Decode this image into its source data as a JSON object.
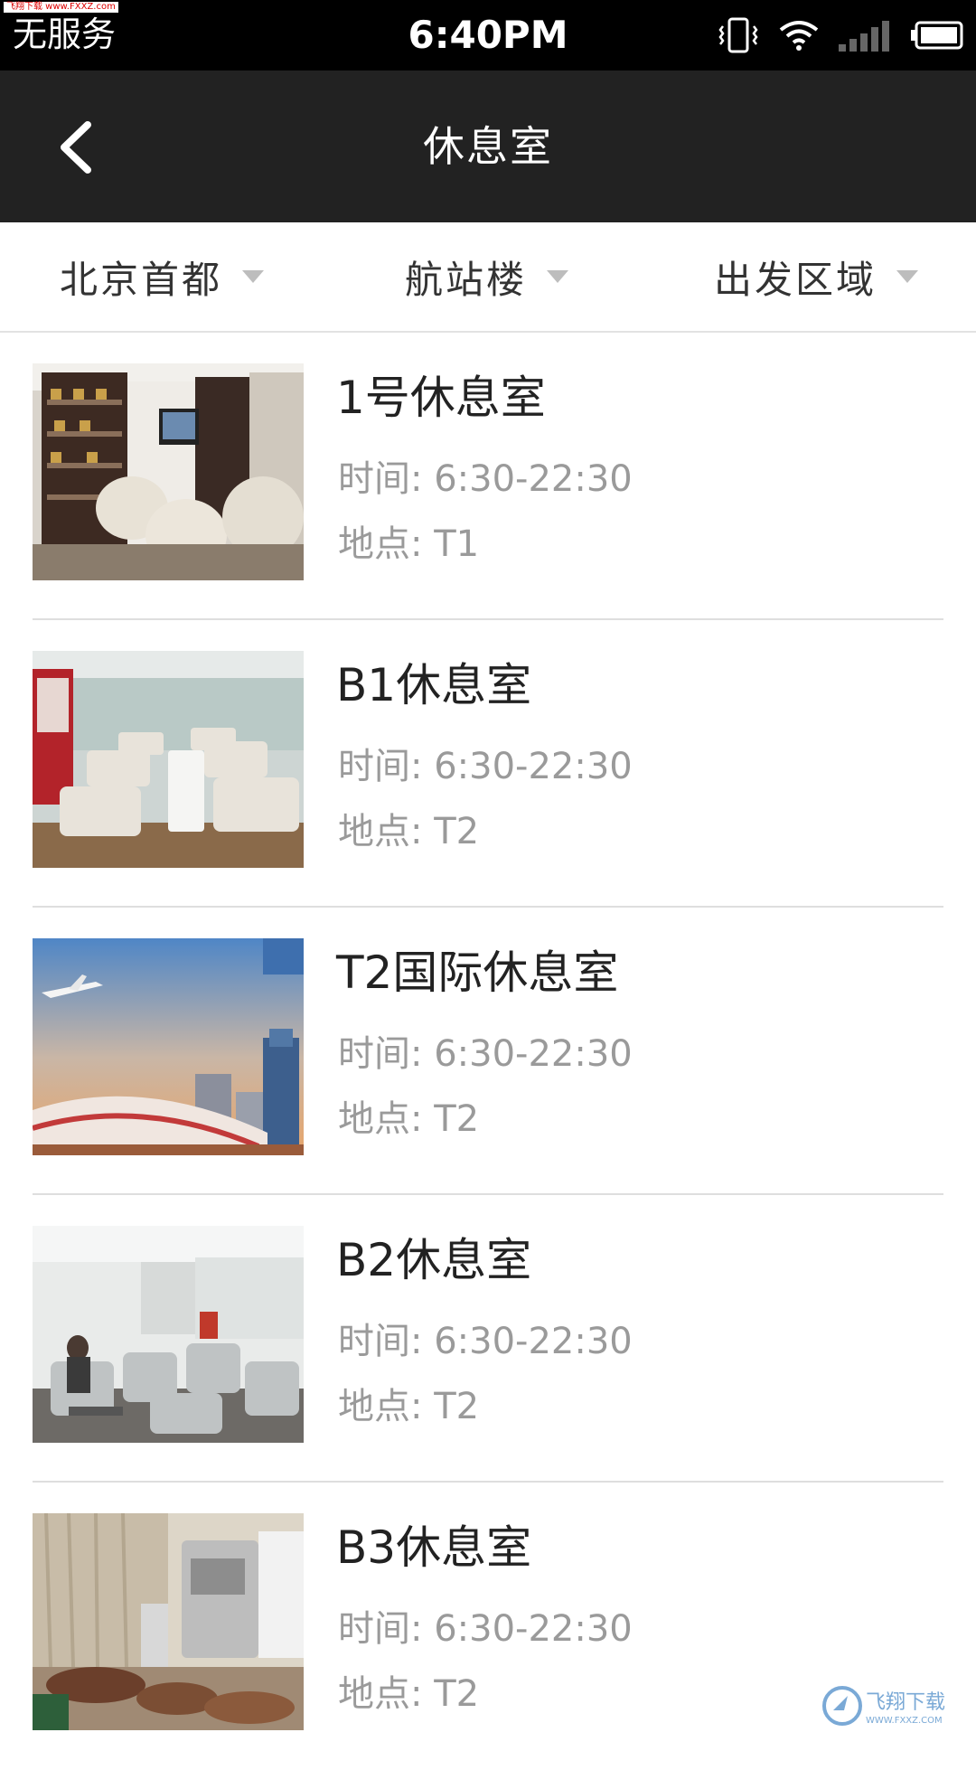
{
  "status_bar": {
    "carrier": "无服务",
    "time": "6:40PM",
    "watermark_badge": "飞翔下载 www.FXXZ.com"
  },
  "nav": {
    "title": "休息室",
    "back_icon": "chevron-left-icon"
  },
  "filters": [
    {
      "label": "北京首都"
    },
    {
      "label": "航站楼"
    },
    {
      "label": "出发区域"
    }
  ],
  "lounges": [
    {
      "title": "1号休息室",
      "time": "时间:  6:30-22:30",
      "location": "地点:  T1"
    },
    {
      "title": "B1休息室",
      "time": "时间:  6:30-22:30",
      "location": "地点:  T2"
    },
    {
      "title": "T2国际休息室",
      "time": "时间:  6:30-22:30",
      "location": "地点:  T2"
    },
    {
      "title": "B2休息室",
      "time": "时间:  6:30-22:30",
      "location": "地点:  T2"
    },
    {
      "title": "B3休息室",
      "time": "时间:  6:30-22:30",
      "location": "地点:  T2"
    }
  ],
  "watermark": {
    "text": "飞翔下载",
    "url": "WWW.FXXZ.COM"
  },
  "colors": {
    "nav_bg": "#222222",
    "status_bg": "#000000",
    "secondary_text": "#9a9a9a"
  }
}
